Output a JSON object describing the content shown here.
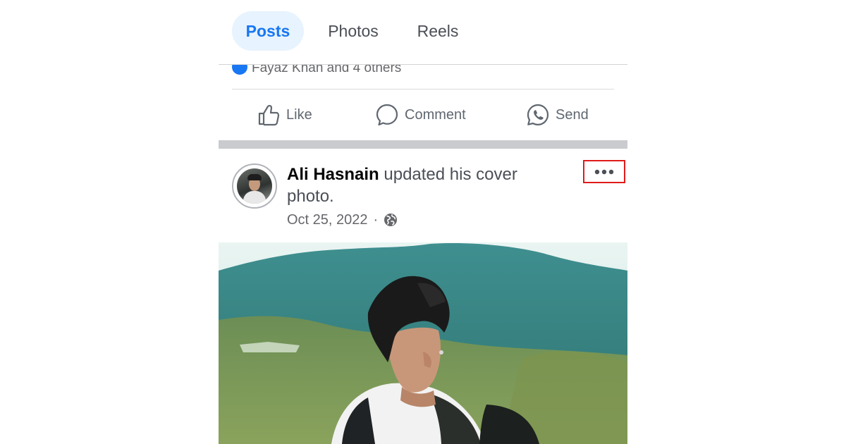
{
  "tabs": [
    {
      "label": "Posts",
      "active": true
    },
    {
      "label": "Photos",
      "active": false
    },
    {
      "label": "Reels",
      "active": false
    }
  ],
  "reactions": {
    "text": "Fayaz Khan and 4 others"
  },
  "actions": {
    "like_label": "Like",
    "comment_label": "Comment",
    "send_label": "Send"
  },
  "post": {
    "author": "Ali Hasnain",
    "activity": " updated his cover photo.",
    "date": "Oct 25, 2022",
    "separator": "·",
    "privacy_icon": "globe-icon",
    "menu_icon": "more-options-icon",
    "cover_photo": "cover-photo"
  },
  "colors": {
    "accent": "#1877f2",
    "active_tab_bg": "#e7f3ff",
    "highlight_box": "#e01b1b",
    "separator": "#c9cbce"
  }
}
